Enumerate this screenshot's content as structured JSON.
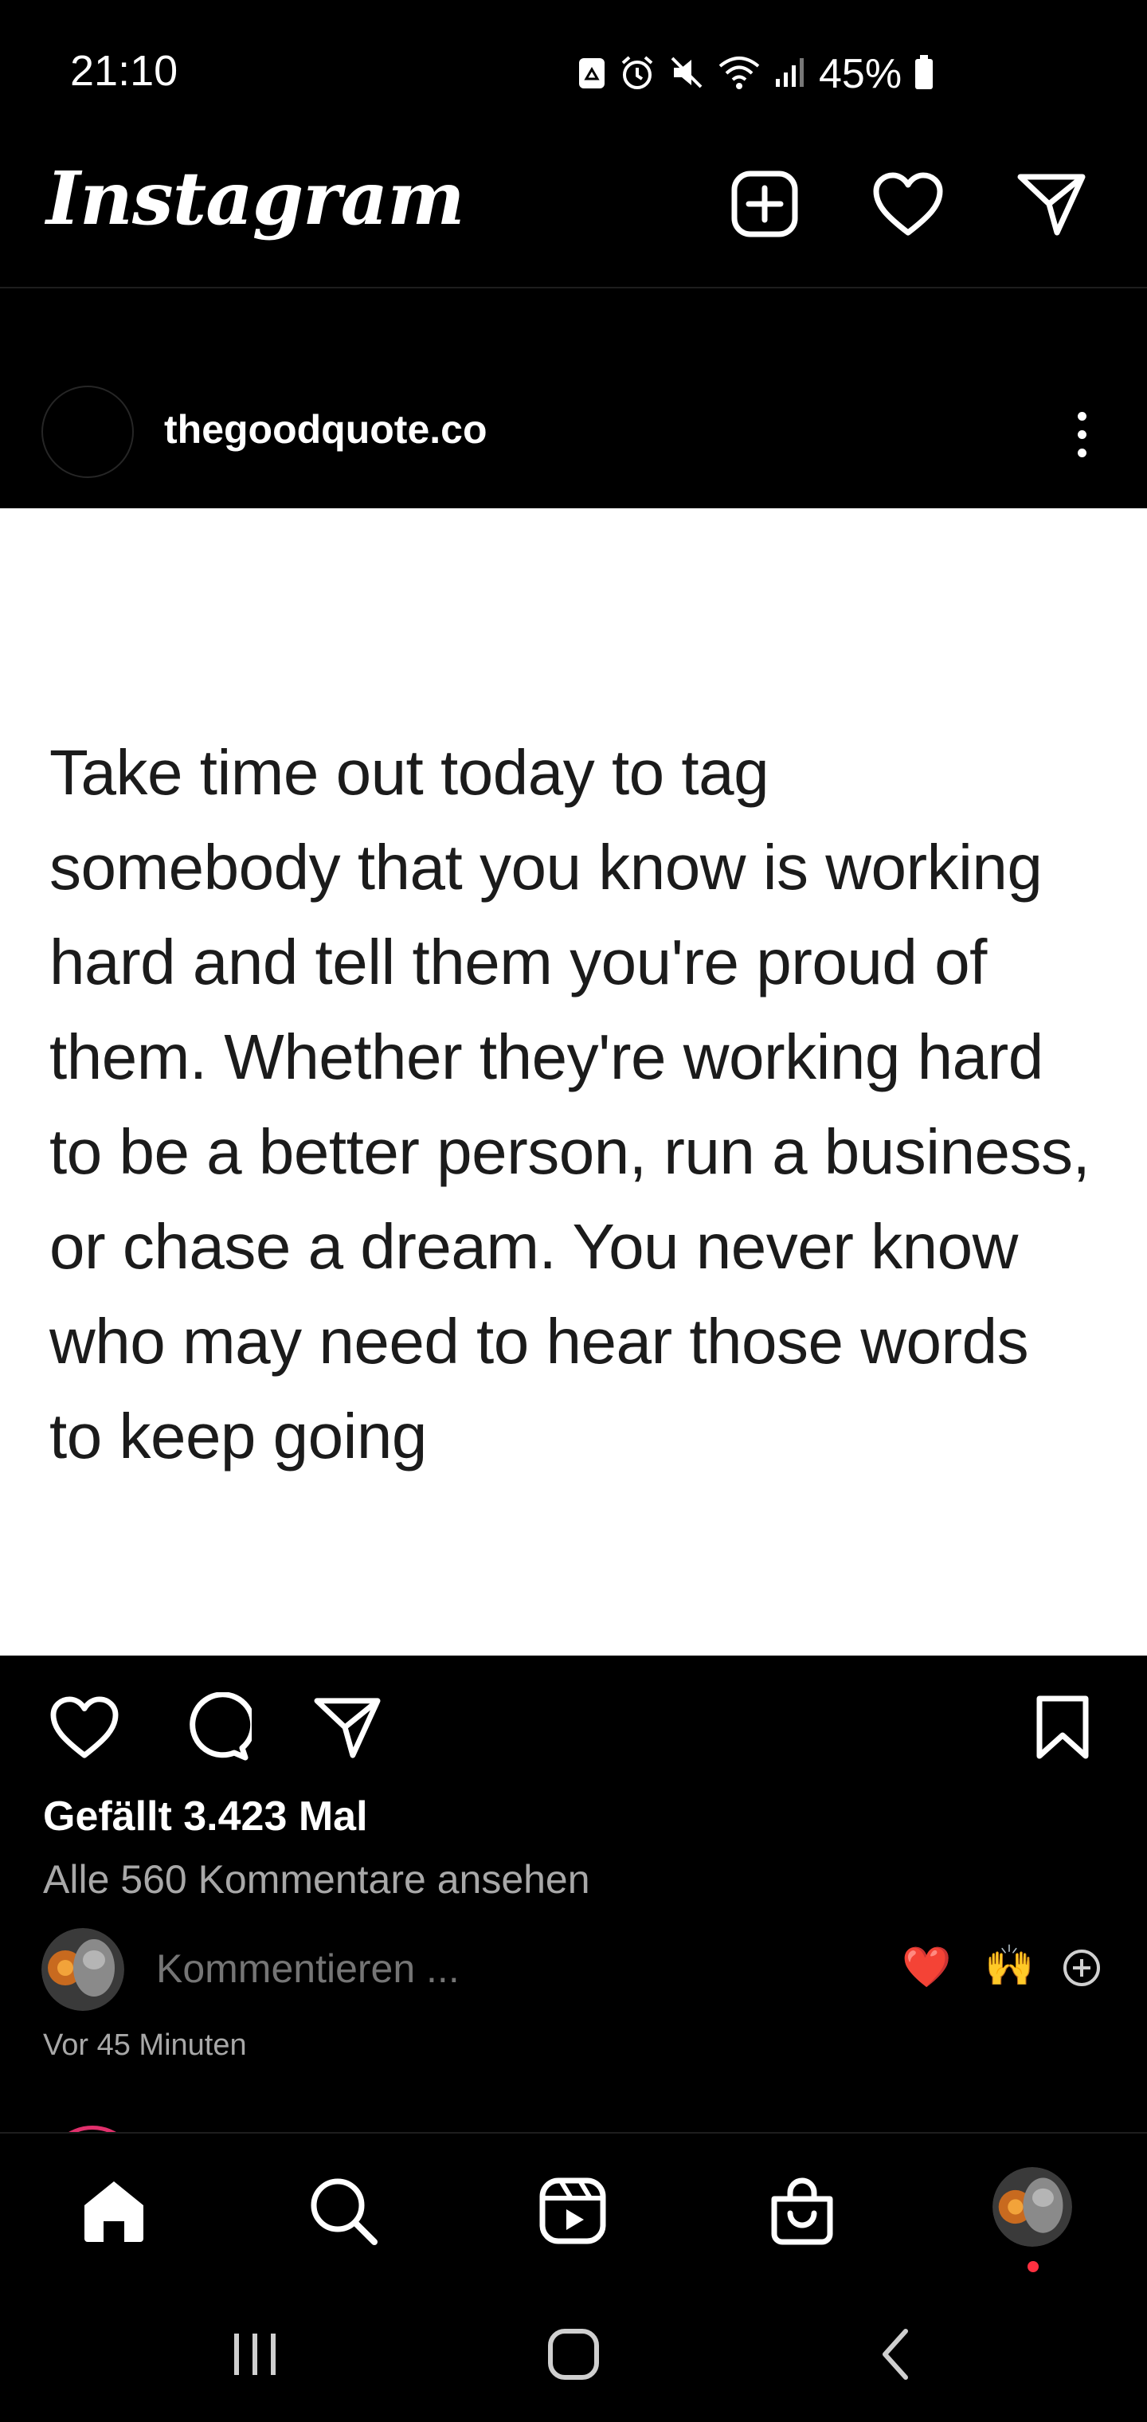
{
  "status_bar": {
    "time": "21:10",
    "battery": "45%",
    "icons": [
      "recycle-icon",
      "alarm-icon",
      "mute-icon",
      "wifi-icon",
      "signal-icon",
      "battery-icon"
    ]
  },
  "app": {
    "logo": "Instagram",
    "top_icons": [
      "new-post-icon",
      "heart-icon",
      "direct-message-icon"
    ]
  },
  "post": {
    "author": "thegoodquote.co",
    "quote_lines": [
      "Take time out today to tag",
      "somebody that you know is working",
      "hard and tell them you're proud of",
      "them. Whether they're working hard",
      "to be a better person, run a business,",
      "or chase a dream. You never know",
      "who may need to hear those words",
      "to keep going"
    ],
    "likes": "Gefällt 3.423 Mal",
    "view_comments": "Alle 560 Kommentare ansehen",
    "comment_placeholder": "Kommentieren ...",
    "quick_emojis": [
      "❤️",
      "🙌"
    ],
    "time_ago": "Vor 45 Minuten"
  },
  "bottom_nav": {
    "items": [
      "home-icon",
      "search-icon",
      "reels-icon",
      "shop-icon",
      "profile-avatar"
    ]
  },
  "system_nav": {
    "items": [
      "recent-apps-icon",
      "home-button-icon",
      "back-icon"
    ]
  },
  "colors": {
    "background": "#000000",
    "text_primary": "#ffffff",
    "text_secondary": "#a8a8a8",
    "quote_text": "#1b1b1b",
    "notification_dot": "#ff3040"
  }
}
